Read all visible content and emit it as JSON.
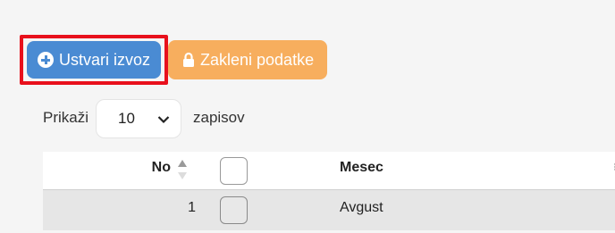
{
  "toolbar": {
    "create_label": "Ustvari izvoz",
    "lock_label": "Zakleni podatke"
  },
  "length_menu": {
    "prefix": "Prikaži",
    "value": "10",
    "suffix": "zapisov"
  },
  "table": {
    "columns": {
      "no": "No",
      "month": "Mesec"
    },
    "rows": [
      {
        "no": "1",
        "month": "Avgust"
      }
    ]
  },
  "colors": {
    "primary": "#4a8bd3",
    "warning": "#f7ae5e",
    "highlight": "#e8101c"
  },
  "icons": {
    "create": "plus-circle-icon",
    "lock": "lock-icon",
    "select": "chevron-down-icon",
    "sort": "sort-icon"
  }
}
